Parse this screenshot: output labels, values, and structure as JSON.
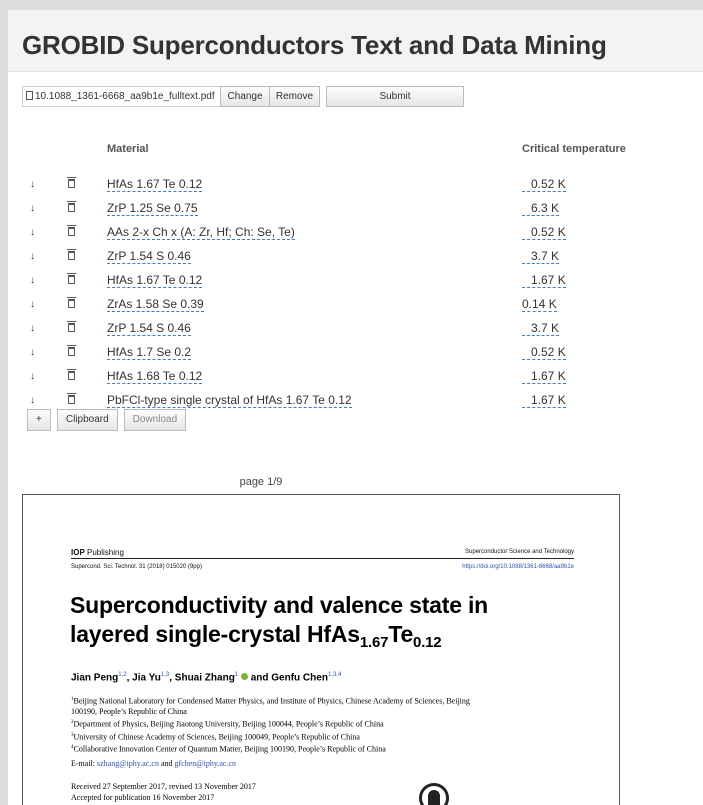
{
  "app": {
    "title": "GROBID Superconductors Text and Data Mining"
  },
  "file": {
    "name": "10.1088_1361-6668_aa9b1e_fulltext.pdf",
    "change_label": "Change",
    "remove_label": "Remove",
    "submit_label": "Submit"
  },
  "table": {
    "headers": {
      "material": "Material",
      "tc": "Critical temperature"
    },
    "rows": [
      {
        "material": "HfAs 1.67 Te 0.12",
        "tc": "0.52 K",
        "has_icon": true
      },
      {
        "material": "ZrP 1.25 Se 0.75",
        "tc": "6.3 K",
        "has_icon": true
      },
      {
        "material": "AAs 2-x Ch x (A: Zr, Hf; Ch: Se, Te)",
        "tc": "0.52 K",
        "has_icon": true
      },
      {
        "material": "ZrP 1.54 S 0.46",
        "tc": "3.7 K",
        "has_icon": true
      },
      {
        "material": "HfAs 1.67 Te 0.12",
        "tc": "1.67 K",
        "has_icon": true
      },
      {
        "material": "ZrAs 1.58 Se 0.39",
        "tc": "0.14 K",
        "has_icon": false
      },
      {
        "material": "ZrP 1.54 S 0.46",
        "tc": "3.7 K",
        "has_icon": true
      },
      {
        "material": "HfAs 1.7 Se 0.2",
        "tc": "0.52 K",
        "has_icon": true
      },
      {
        "material": "HfAs 1.68 Te 0.12",
        "tc": "1.67 K",
        "has_icon": true
      },
      {
        "material": "PbFCl-type single crystal of HfAs 1.67 Te 0.12",
        "tc": "1.67 K",
        "has_icon": true
      }
    ],
    "row_arrow_icon": "arrow-down-icon",
    "row_delete_icon": "trash-icon",
    "row_arrow_glyph": "↓"
  },
  "actions": {
    "add_label": "+",
    "clipboard_label": "Clipboard",
    "download_label": "Download"
  },
  "pager": {
    "label": "page 1/9"
  },
  "pdf": {
    "publisher_bold": "IOP",
    "publisher_rest": " Publishing",
    "journal": "Superconductor Science and Technology",
    "citation": "Supercond. Sci. Technol. 31 (2018) 015020 (9pp)",
    "doi": "https://doi.org/10.1088/1361-6668/aa9b1e",
    "title_line1": "Superconductivity and valence state in",
    "title_line2_a": "layered single-crystal HfAs",
    "title_sub1": "1.67",
    "title_line2_b": "Te",
    "title_sub2": "0.12",
    "authors": [
      {
        "name": "Jian Peng",
        "sup": "1,2"
      },
      {
        "name": "Jia Yu",
        "sup": "1,3"
      },
      {
        "name": "Shuai Zhang",
        "sup": "1"
      },
      {
        "name": "Genfu Chen",
        "sup": "1,3,4"
      }
    ],
    "and_label": " and ",
    "affiliations": [
      {
        "sup": "1",
        "text": "Beijing National Laboratory for Condensed Matter Physics, and Institute of Physics, Chinese Academy of Sciences, Beijing 100190, People’s Republic of China"
      },
      {
        "sup": "2",
        "text": "Department of Physics, Beijing Jiaotong University, Beijing 100044, People’s Republic of China"
      },
      {
        "sup": "3",
        "text": "University of Chinese Academy of Sciences, Beijing 100049, People’s Republic of China"
      },
      {
        "sup": "4",
        "text": "Collaborative Innovation Center of Quantum Matter, Beijing 100190, People’s Republic of China"
      }
    ],
    "email_label": "E-mail: ",
    "email1": "szhang@iphy.ac.cn",
    "email_and": " and ",
    "email2": "gfchen@iphy.ac.cn",
    "received": "Received 27 September 2017, revised 13 November 2017",
    "accepted": "Accepted for publication 16 November 2017"
  },
  "colors": {
    "link_underline": "#3d7fc4",
    "doi_link": "#2a52be",
    "orcid": "#7bb531"
  }
}
